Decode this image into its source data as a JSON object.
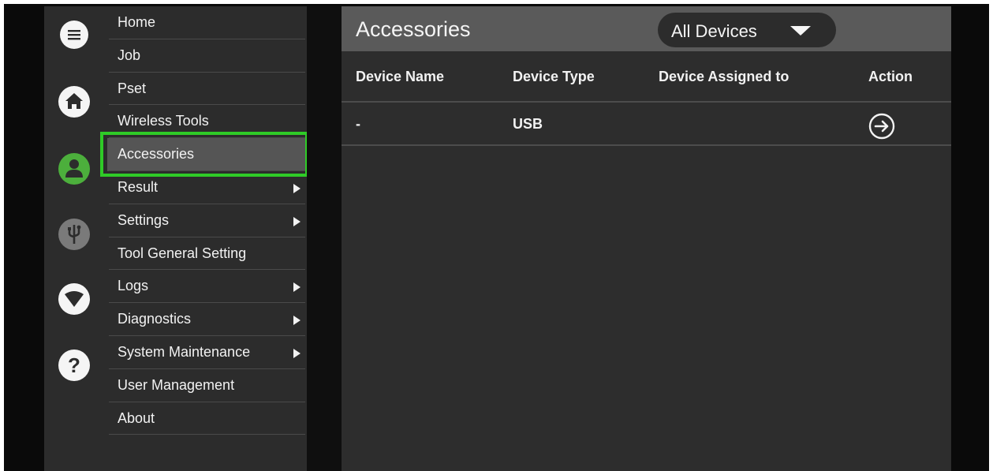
{
  "menu": {
    "items": [
      {
        "label": "Home",
        "submenu": false
      },
      {
        "label": "Job",
        "submenu": false
      },
      {
        "label": "Pset",
        "submenu": false
      },
      {
        "label": "Wireless Tools",
        "submenu": false
      },
      {
        "label": "Accessories",
        "submenu": false,
        "active": true
      },
      {
        "label": "Result",
        "submenu": true
      },
      {
        "label": "Settings",
        "submenu": true
      },
      {
        "label": "Tool General Setting",
        "submenu": false
      },
      {
        "label": "Logs",
        "submenu": true
      },
      {
        "label": "Diagnostics",
        "submenu": true
      },
      {
        "label": "System Maintenance",
        "submenu": true
      },
      {
        "label": "User Management",
        "submenu": false
      },
      {
        "label": "About",
        "submenu": false
      }
    ]
  },
  "rail": {
    "icons": [
      "hamburger-menu-icon",
      "home-icon",
      "user-icon",
      "usb-icon",
      "wifi-icon",
      "help-icon"
    ],
    "active_icon": "user-icon",
    "active_color": "#4caf3c"
  },
  "main": {
    "title": "Accessories",
    "device_filter": {
      "selected": "All Devices"
    },
    "table": {
      "headers": [
        "Device Name",
        "Device Type",
        "Device Assigned to",
        "Action"
      ],
      "rows": [
        {
          "device_name": "-",
          "device_type": "USB",
          "device_assigned_to": "",
          "action_icon": "arrow-right-circle-icon"
        }
      ]
    }
  },
  "colors": {
    "highlight_outline": "#2fcb27",
    "menu_bg": "#2c2c2c",
    "header_bg": "#5a5a5a"
  }
}
